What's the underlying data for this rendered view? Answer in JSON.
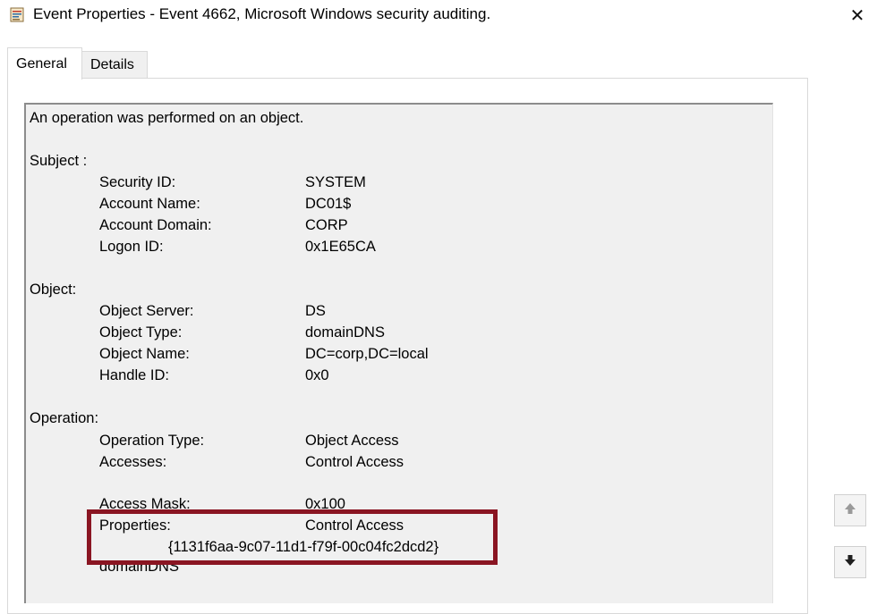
{
  "window": {
    "title": "Event Properties - Event 4662, Microsoft Windows security auditing.",
    "close_glyph": "✕"
  },
  "tabs": [
    {
      "label": "General"
    },
    {
      "label": "Details"
    }
  ],
  "description": {
    "intro": "An operation was performed on an object.",
    "subject": {
      "heading": "Subject :",
      "rows": [
        {
          "label": "Security ID:",
          "value": "SYSTEM"
        },
        {
          "label": "Account Name:",
          "value": "DC01$"
        },
        {
          "label": "Account Domain:",
          "value": "CORP"
        },
        {
          "label": "Logon ID:",
          "value": "0x1E65CA"
        }
      ]
    },
    "object": {
      "heading": "Object:",
      "rows": [
        {
          "label": "Object Server:",
          "value": "DS"
        },
        {
          "label": "Object Type:",
          "value": "domainDNS"
        },
        {
          "label": "Object Name:",
          "value": "DC=corp,DC=local"
        },
        {
          "label": "Handle ID:",
          "value": "0x0"
        }
      ]
    },
    "operation": {
      "heading": "Operation:",
      "rows": [
        {
          "label": "Operation Type:",
          "value": "Object Access"
        },
        {
          "label": "Accesses:",
          "value": "Control Access"
        }
      ],
      "access_mask": {
        "label": "Access Mask:",
        "value": "0x100"
      },
      "properties": {
        "label": "Properties:",
        "value": "Control Access"
      },
      "guid": "{1131f6aa-9c07-11d1-f79f-00c04fc2dcd2}",
      "type_line": "domainDNS"
    }
  },
  "icons": {
    "title": "event-properties-icon",
    "scroll_up": "arrow-up-icon",
    "scroll_down": "arrow-down-icon"
  }
}
